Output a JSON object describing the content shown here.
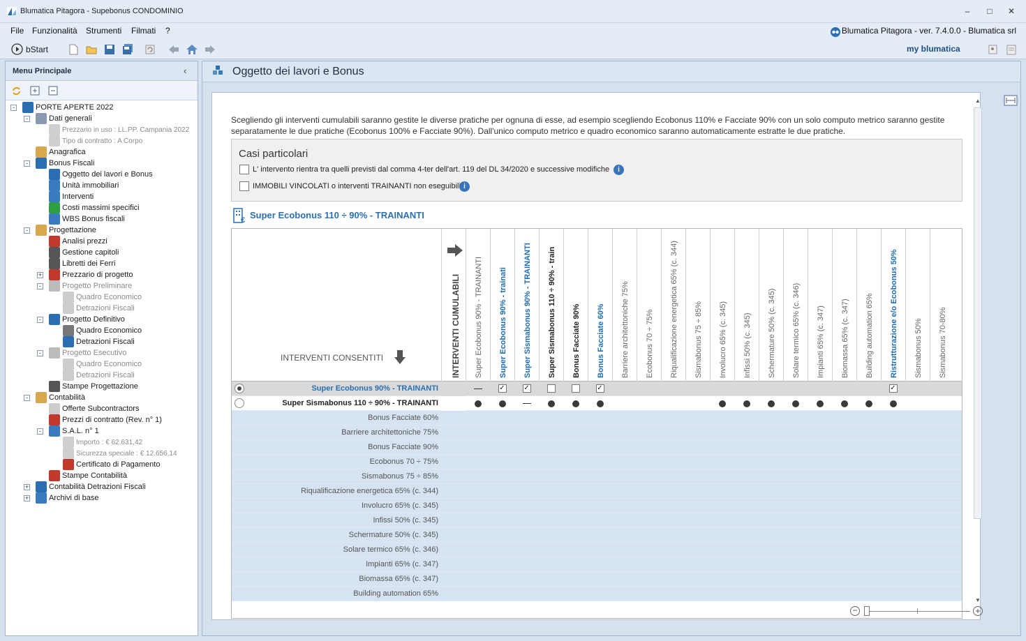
{
  "app": {
    "title": "Blumatica Pitagora - Supebonus CONDOMINIO",
    "version_text": "Blumatica Pitagora - ver. 7.4.0.0 - Blumatica srl"
  },
  "window_controls": {
    "minimize": "–",
    "restore": "□",
    "close": "✕"
  },
  "menu": [
    "File",
    "Funzionalità",
    "Strumenti",
    "Filmati",
    "?"
  ],
  "toolbar": {
    "bstart": "bStart",
    "myblumatica": "my blumatica"
  },
  "left_panel": {
    "title": "Menu Principale",
    "tree": [
      {
        "label": "PORTE APERTE 2022",
        "lvl": 0,
        "dim": false,
        "color": "#2a6fb3"
      },
      {
        "label": "Dati generali",
        "lvl": 1,
        "dim": false,
        "color": "#8a9ab0"
      },
      {
        "label": "Prezzario in uso : LL.PP. Campania 2022",
        "lvl": 2,
        "dim": true,
        "small": true,
        "color": "#cfcfcf"
      },
      {
        "label": "Tipo di contratto : A Corpo",
        "lvl": 2,
        "dim": true,
        "small": true,
        "color": "#cfcfcf"
      },
      {
        "label": "Anagrafica",
        "lvl": 1,
        "dim": false,
        "color": "#d9a84e"
      },
      {
        "label": "Bonus Fiscali",
        "lvl": 1,
        "dim": false,
        "color": "#2a6fb3"
      },
      {
        "label": "Oggetto dei lavori e Bonus",
        "lvl": 2,
        "dim": false,
        "color": "#2a6fb3"
      },
      {
        "label": "Unità immobiliari",
        "lvl": 2,
        "dim": false,
        "color": "#3a7bc0"
      },
      {
        "label": "Interventi",
        "lvl": 2,
        "dim": false,
        "color": "#3a7bc0"
      },
      {
        "label": "Costi massimi specifici",
        "lvl": 2,
        "dim": false,
        "color": "#2ea043"
      },
      {
        "label": "WBS Bonus fiscali",
        "lvl": 2,
        "dim": false,
        "color": "#3a7bc0"
      },
      {
        "label": "Progettazione",
        "lvl": 1,
        "dim": false,
        "color": "#d9a84e"
      },
      {
        "label": "Analisi prezzi",
        "lvl": 2,
        "dim": false,
        "color": "#c0392b"
      },
      {
        "label": "Gestione capitoli",
        "lvl": 2,
        "dim": false,
        "color": "#555"
      },
      {
        "label": "Libretti dei Ferri",
        "lvl": 2,
        "dim": false,
        "color": "#555"
      },
      {
        "label": "Prezzario di progetto",
        "lvl": 2,
        "dim": false,
        "color": "#c0392b"
      },
      {
        "label": "Progetto Preliminare",
        "lvl": 2,
        "dim": true,
        "color": "#bbb"
      },
      {
        "label": "Quadro Economico",
        "lvl": 3,
        "dim": true,
        "color": "#ccc"
      },
      {
        "label": "Detrazioni Fiscali",
        "lvl": 3,
        "dim": true,
        "color": "#ccc"
      },
      {
        "label": "Progetto Definitivo",
        "lvl": 2,
        "dim": false,
        "color": "#2a6fb3"
      },
      {
        "label": "Quadro Economico",
        "lvl": 3,
        "dim": false,
        "color": "#777"
      },
      {
        "label": "Detrazioni Fiscali",
        "lvl": 3,
        "dim": false,
        "color": "#2a6fb3"
      },
      {
        "label": "Progetto Esecutivo",
        "lvl": 2,
        "dim": true,
        "color": "#bbb"
      },
      {
        "label": "Quadro Economico",
        "lvl": 3,
        "dim": true,
        "color": "#ccc"
      },
      {
        "label": "Detrazioni Fiscali",
        "lvl": 3,
        "dim": true,
        "color": "#ccc"
      },
      {
        "label": "Stampe Progettazione",
        "lvl": 2,
        "dim": false,
        "color": "#555"
      },
      {
        "label": "Contabilità",
        "lvl": 1,
        "dim": false,
        "color": "#d9a84e"
      },
      {
        "label": "Offerte Subcontractors",
        "lvl": 2,
        "dim": false,
        "color": "#ccc"
      },
      {
        "label": "Prezzi di contratto (Rev. n° 1)",
        "lvl": 2,
        "dim": false,
        "color": "#c0392b"
      },
      {
        "label": "S.A.L. n° 1",
        "lvl": 2,
        "dim": false,
        "color": "#3a7bc0"
      },
      {
        "label": "Importo : € 62.631,42",
        "lvl": 3,
        "dim": true,
        "small": true,
        "color": "#cfcfcf"
      },
      {
        "label": "Sicurezza speciale   : € 12.656,14",
        "lvl": 3,
        "dim": true,
        "small": true,
        "color": "#cfcfcf"
      },
      {
        "label": "Certificato di Pagamento",
        "lvl": 3,
        "dim": false,
        "color": "#c0392b"
      },
      {
        "label": "Stampe Contabilità",
        "lvl": 2,
        "dim": false,
        "color": "#c0392b"
      },
      {
        "label": "Contabilità Detrazioni Fiscali",
        "lvl": 1,
        "dim": false,
        "color": "#2a6fb3"
      },
      {
        "label": "Archivi di base",
        "lvl": 1,
        "dim": false,
        "color": "#3a7bc0"
      }
    ]
  },
  "main": {
    "title": "Oggetto dei lavori e Bonus",
    "description": "Scegliendo gli interventi cumulabili saranno gestite le diverse pratiche per ognuna di esse, ad esempio scegliendo Ecobonus 110% e Facciate 90% con un solo computo metrico saranno gestite separatamente le due pratiche (Ecobonus 100% e Facciate 90%). Dall'unico computo metrico e quadro economico saranno automaticamente estratte le due pratiche.",
    "casi_particolari": {
      "title": "Casi particolari",
      "options": [
        "L' intervento rientra tra quelli previsti dal comma 4-ter dell'art. 119 del DL 34/2020 e successive modifiche",
        "IMMOBILI VINCOLATI o interventi TRAINANTI non eseguibili"
      ]
    },
    "section_title": "Super Ecobonus 110 ÷ 90% - TRAINANTI",
    "grid": {
      "corner_label": "INTERVENTI CONSENTITI",
      "cumul_label": "INTERVENTI CUMULABILI",
      "columns": [
        {
          "label": "Super Ecobonus 90% - TRAINANTI",
          "style": "normal"
        },
        {
          "label": "Super Ecobonus 90% - trainati",
          "style": "blue"
        },
        {
          "label": "Super Sismabonus 90% - TRAINANTI",
          "style": "blue"
        },
        {
          "label": "Super Sismabonus 110 ÷ 90% - train",
          "style": "bold"
        },
        {
          "label": "Bonus Facciate 90%",
          "style": "bold"
        },
        {
          "label": "Bonus Facciate 60%",
          "style": "blue"
        },
        {
          "label": "Barriere architettoniche 75%",
          "style": "normal"
        },
        {
          "label": "Ecobonus 70 ÷ 75%",
          "style": "normal"
        },
        {
          "label": "Riqualificazione energetica 65% (c. 344)",
          "style": "normal"
        },
        {
          "label": "Sismabonus 75 ÷ 85%",
          "style": "normal"
        },
        {
          "label": "Involucro 65% (c. 345)",
          "style": "normal"
        },
        {
          "label": "Infissi 50% (c. 345)",
          "style": "normal"
        },
        {
          "label": "Schermature 50% (c. 345)",
          "style": "normal"
        },
        {
          "label": "Solare termico 65% (c. 346)",
          "style": "normal"
        },
        {
          "label": "Impianti 65% (c. 347)",
          "style": "normal"
        },
        {
          "label": "Biomassa 65% (c. 347)",
          "style": "normal"
        },
        {
          "label": "Building automation 65%",
          "style": "normal"
        },
        {
          "label": "Ristrutturazione e/o Ecobonus 50%",
          "style": "blue"
        },
        {
          "label": "Sismabonus 50%",
          "style": "normal"
        },
        {
          "label": "Sismabonus 70-80%",
          "style": "normal"
        }
      ],
      "rows": [
        {
          "label": "Super Ecobonus 90% - TRAINANTI",
          "style": "selected",
          "radio": "on",
          "cells": [
            "dash",
            "check",
            "check",
            "box",
            "box",
            "check",
            "",
            "",
            "",
            "",
            "",
            "",
            "",
            "",
            "",
            "",
            "",
            "check",
            "",
            ""
          ]
        },
        {
          "label": "Super Sismabonus 110 ÷ 90% - TRAINANTI",
          "style": "bold",
          "radio": "off",
          "cells": [
            "dot",
            "dot",
            "dash",
            "dot",
            "dot",
            "dot",
            "",
            "",
            "",
            "",
            "dot",
            "dot",
            "dot",
            "dot",
            "dot",
            "dot",
            "dot",
            "dot",
            "",
            ""
          ]
        },
        {
          "label": "Bonus Facciate 60%",
          "style": "muted"
        },
        {
          "label": "Barriere architettoniche 75%",
          "style": "muted"
        },
        {
          "label": "Bonus Facciate 90%",
          "style": "muted"
        },
        {
          "label": "Ecobonus 70 ÷ 75%",
          "style": "muted"
        },
        {
          "label": "Sismabonus 75 ÷ 85%",
          "style": "muted"
        },
        {
          "label": "Riqualificazione energetica 65% (c. 344)",
          "style": "muted"
        },
        {
          "label": "Involucro 65% (c. 345)",
          "style": "muted"
        },
        {
          "label": "Infissi 50% (c. 345)",
          "style": "muted"
        },
        {
          "label": "Schermature 50% (c. 345)",
          "style": "muted"
        },
        {
          "label": "Solare termico 65% (c. 346)",
          "style": "muted"
        },
        {
          "label": "Impianti 65% (c. 347)",
          "style": "muted"
        },
        {
          "label": "Biomassa 65% (c. 347)",
          "style": "muted"
        },
        {
          "label": "Building automation 65%",
          "style": "muted"
        }
      ]
    }
  },
  "colors": {
    "accent": "#2a6fb3",
    "panel_bg": "#dbe6f3",
    "selected_row": "#d9d9d9",
    "muted_row": "#d6e3f2"
  }
}
